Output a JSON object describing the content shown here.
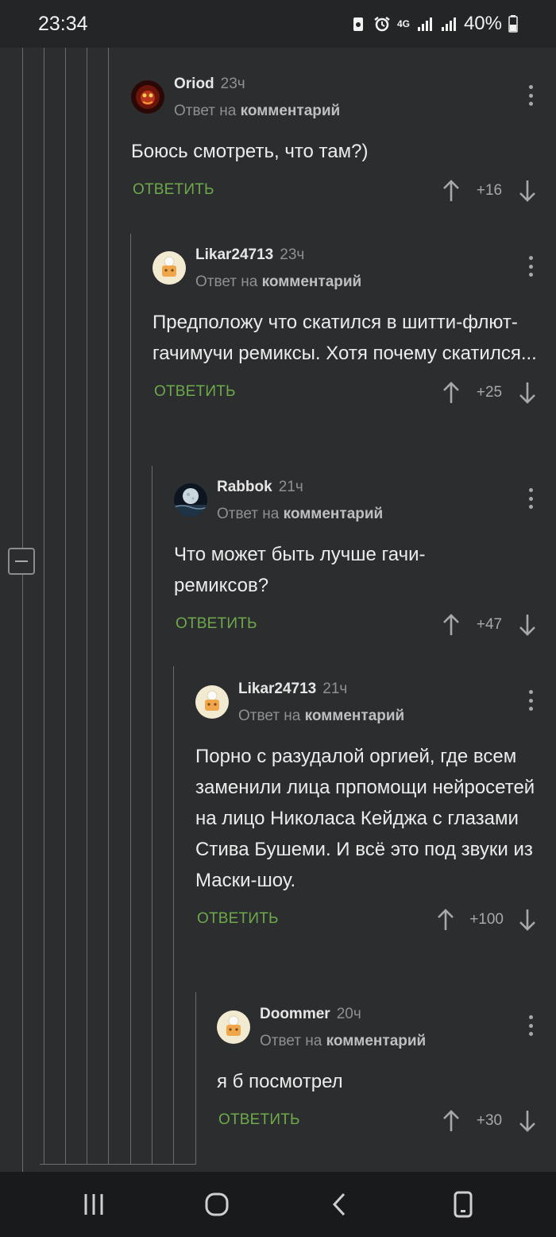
{
  "status": {
    "time": "23:34",
    "network": "4G",
    "battery": "40%"
  },
  "comments": [
    {
      "author": "Oriod",
      "time": "23ч",
      "reply_prefix": "Ответ на",
      "reply_target": "комментарий",
      "text": "Боюсь смотреть, что там?)",
      "reply_label": "ОТВЕТИТЬ",
      "score": "+16"
    },
    {
      "author": "Likar24713",
      "time": "23ч",
      "reply_prefix": "Ответ на",
      "reply_target": "комментарий",
      "text": "Предположу что скатился в шитти-флют-гачимучи ремиксы. Хотя почему скатился...",
      "reply_label": "ОТВЕТИТЬ",
      "score": "+25"
    },
    {
      "author": "Rabbok",
      "time": "21ч",
      "reply_prefix": "Ответ на",
      "reply_target": "комментарий",
      "text": "Что может быть лучше гачи-ремиксов?",
      "reply_label": "ОТВЕТИТЬ",
      "score": "+47"
    },
    {
      "author": "Likar24713",
      "time": "21ч",
      "reply_prefix": "Ответ на",
      "reply_target": "комментарий",
      "text": "Порно с разудалой оргией, где всем заменили лица прпомощи нейросетей на лицо Николаса Кейджа с глазами Стива Бушеми. И всё это под звуки из Маски-шоу.",
      "reply_label": "ОТВЕТИТЬ",
      "score": "+100"
    },
    {
      "author": "Doommer",
      "time": "20ч",
      "reply_prefix": "Ответ на",
      "reply_target": "комментарий",
      "text": "я б посмотрел",
      "reply_label": "ОТВЕТИТЬ",
      "score": "+30"
    }
  ]
}
